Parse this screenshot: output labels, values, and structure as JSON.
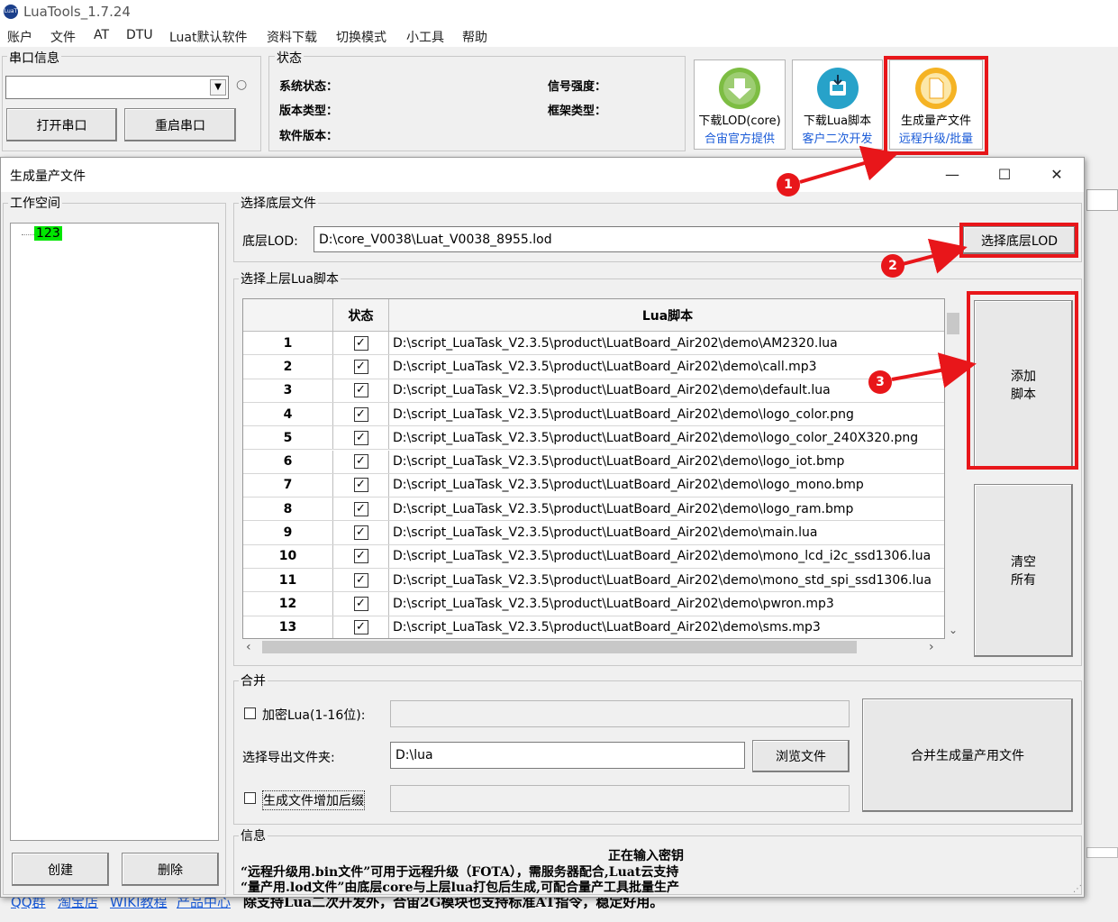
{
  "app": {
    "title": "LuaTools_1.7.24",
    "logo_text": "LuaT"
  },
  "menu": [
    "账户",
    "文件",
    "AT",
    "DTU",
    "Luat默认软件",
    "资料下载",
    "切换模式",
    "小工具",
    "帮助"
  ],
  "serial": {
    "group_label": "串口信息",
    "combo_value": "",
    "open_button": "打开串口",
    "restart_button": "重启串口"
  },
  "status": {
    "group_label": "状态",
    "system_status": "系统状态：",
    "version_type": "版本类型：",
    "software_version": "软件版本：",
    "signal_strength": "信号强度：",
    "frame_type": "框架类型："
  },
  "toolbar": [
    {
      "line1": "下载LOD(core)",
      "line2": "合宙官方提供",
      "icon": "download-lod-icon",
      "color": "#7dbd43"
    },
    {
      "line1": "下载Lua脚本",
      "line2": "客户二次开发",
      "icon": "download-script-icon",
      "color": "#27a2c9"
    },
    {
      "line1": "生成量产文件",
      "line2": "远程升级/批量",
      "icon": "generate-file-icon",
      "color": "#f5b324"
    }
  ],
  "dialog": {
    "title": "生成量产文件",
    "controls": {
      "minimize": "—",
      "maximize": "☐",
      "close": "✕"
    },
    "workspace": {
      "group_label": "工作空间",
      "tree_item": "123",
      "create_button": "创建",
      "delete_button": "删除"
    },
    "base_file": {
      "group_label": "选择底层文件",
      "label": "底层LOD:",
      "path": "D:\\core_V0038\\Luat_V0038_8955.lod",
      "button": "选择底层LOD"
    },
    "lua_scripts": {
      "group_label": "选择上层Lua脚本",
      "col_status": "状态",
      "col_script": "Lua脚本",
      "rows": [
        {
          "idx": "1",
          "checked": "✓",
          "path": "D:\\script_LuaTask_V2.3.5\\product\\LuatBoard_Air202\\demo\\AM2320.lua"
        },
        {
          "idx": "2",
          "checked": "✓",
          "path": "D:\\script_LuaTask_V2.3.5\\product\\LuatBoard_Air202\\demo\\call.mp3"
        },
        {
          "idx": "3",
          "checked": "✓",
          "path": "D:\\script_LuaTask_V2.3.5\\product\\LuatBoard_Air202\\demo\\default.lua"
        },
        {
          "idx": "4",
          "checked": "✓",
          "path": "D:\\script_LuaTask_V2.3.5\\product\\LuatBoard_Air202\\demo\\logo_color.png"
        },
        {
          "idx": "5",
          "checked": "✓",
          "path": "D:\\script_LuaTask_V2.3.5\\product\\LuatBoard_Air202\\demo\\logo_color_240X320.png"
        },
        {
          "idx": "6",
          "checked": "✓",
          "path": "D:\\script_LuaTask_V2.3.5\\product\\LuatBoard_Air202\\demo\\logo_iot.bmp"
        },
        {
          "idx": "7",
          "checked": "✓",
          "path": "D:\\script_LuaTask_V2.3.5\\product\\LuatBoard_Air202\\demo\\logo_mono.bmp"
        },
        {
          "idx": "8",
          "checked": "✓",
          "path": "D:\\script_LuaTask_V2.3.5\\product\\LuatBoard_Air202\\demo\\logo_ram.bmp"
        },
        {
          "idx": "9",
          "checked": "✓",
          "path": "D:\\script_LuaTask_V2.3.5\\product\\LuatBoard_Air202\\demo\\main.lua"
        },
        {
          "idx": "10",
          "checked": "✓",
          "path": "D:\\script_LuaTask_V2.3.5\\product\\LuatBoard_Air202\\demo\\mono_lcd_i2c_ssd1306.lua"
        },
        {
          "idx": "11",
          "checked": "✓",
          "path": "D:\\script_LuaTask_V2.3.5\\product\\LuatBoard_Air202\\demo\\mono_std_spi_ssd1306.lua"
        },
        {
          "idx": "12",
          "checked": "✓",
          "path": "D:\\script_LuaTask_V2.3.5\\product\\LuatBoard_Air202\\demo\\pwron.mp3"
        },
        {
          "idx": "13",
          "checked": "✓",
          "path": "D:\\script_LuaTask_V2.3.5\\product\\LuatBoard_Air202\\demo\\sms.mp3"
        }
      ],
      "add_button_line1": "添加",
      "add_button_line2": "脚本",
      "clear_button_line1": "清空",
      "clear_button_line2": "所有"
    },
    "merge": {
      "group_label": "合并",
      "encrypt_label": "加密Lua(1-16位):",
      "encrypt_value": "",
      "export_label": "选择导出文件夹:",
      "export_value": "D:\\lua",
      "browse_button": "浏览文件",
      "suffix_label": "生成文件增加后缀",
      "suffix_value": "",
      "merge_button": "合并生成量产用文件"
    },
    "info": {
      "group_label": "信息",
      "line1": "正在输入密钥",
      "line2": "“远程升级用.bin文件”可用于远程升级（FOTA），需服务器配合,Luat云支持",
      "line3": "“量产用.lod文件”由底层core与上层lua打包后生成,可配合量产工具批量生产"
    }
  },
  "background_footer": {
    "links": [
      "QQ群",
      "淘宝店",
      "WIKI教程",
      "产品中心"
    ],
    "text": "除支持Lua二次开发外，合宙2G模块也支持标准AT指令，稳定好用。"
  },
  "annotations": [
    "1",
    "2",
    "3"
  ],
  "colors": {
    "highlight_red": "#e8161a",
    "tree_item_bg": "#00e600",
    "link_blue": "#1a5bd8"
  }
}
